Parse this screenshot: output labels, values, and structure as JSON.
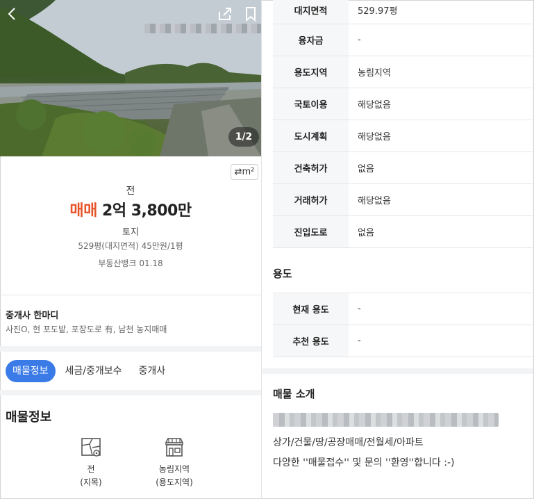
{
  "photo": {
    "counter": "1/2"
  },
  "unit_toggle_label": "⇄m²",
  "listing": {
    "type": "전",
    "deal_label": "매매",
    "price": "2억 3,800만",
    "category": "토지",
    "area_line": "529평(대지면적)  45만원/1평",
    "source": "부동산뱅크 01.18"
  },
  "agent": {
    "title": "중개사 한마디",
    "text": "사진O, 현 포도밭, 포장도로 有, 남천 농지매매"
  },
  "tabs": [
    "매물정보",
    "세금/중개보수",
    "중개사"
  ],
  "section_title": "매물정보",
  "info_items": [
    {
      "line1": "전",
      "line2": "(지목)"
    },
    {
      "line1": "농림지역",
      "line2": "(용도지역)"
    }
  ],
  "land_table": [
    {
      "key": "대지면적",
      "value": "529.97평"
    },
    {
      "key": "융자금",
      "value": "-"
    },
    {
      "key": "용도지역",
      "value": "농림지역"
    },
    {
      "key": "국토이용",
      "value": "해당없음"
    },
    {
      "key": "도시계획",
      "value": "해당없음"
    },
    {
      "key": "건축허가",
      "value": "없음"
    },
    {
      "key": "거래허가",
      "value": "해당없음"
    },
    {
      "key": "진입도로",
      "value": "없음"
    }
  ],
  "usage_title": "용도",
  "usage_table": [
    {
      "key": "현재 용도",
      "value": "-"
    },
    {
      "key": "추천 용도",
      "value": "-"
    }
  ],
  "intro": {
    "title": "매물 소개",
    "line1": "상가/건물/땅/공장매매/전월세/아파트",
    "line2": "다양한 ''매물접수'' 및 문의 ''환영''합니다 :-)"
  },
  "colors": {
    "accent": "#3b7be8",
    "deal": "#e8542a"
  }
}
